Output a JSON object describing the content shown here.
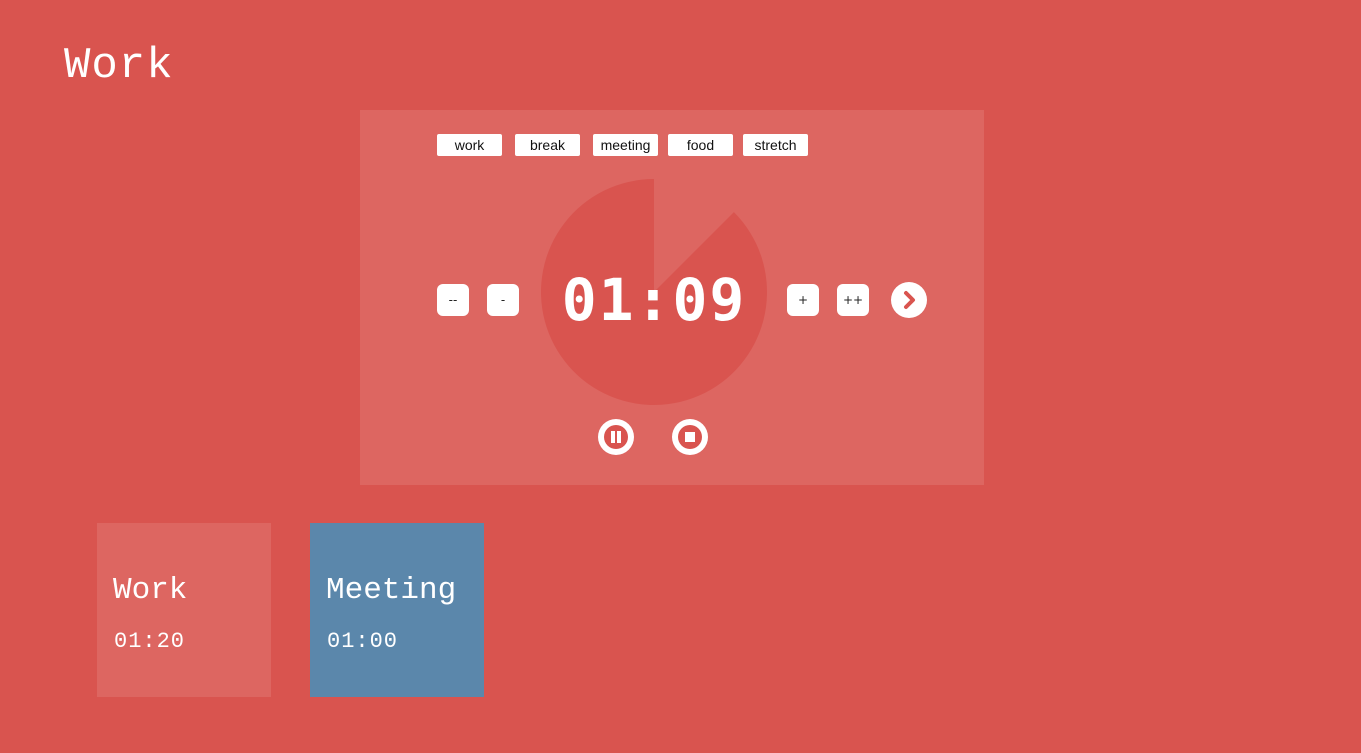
{
  "page": {
    "title": "Work"
  },
  "tags": [
    {
      "label": "work"
    },
    {
      "label": "break"
    },
    {
      "label": "meeting"
    },
    {
      "label": "food"
    },
    {
      "label": "stretch"
    }
  ],
  "timer": {
    "time": "01:09",
    "decrease_large_label": "--",
    "decrease_label": "-",
    "increase_label": "+",
    "increase_large_label": "++",
    "remaining_fraction": 0.875
  },
  "cards": [
    {
      "title": "Work",
      "time": "01:20",
      "color": "#dd6661"
    },
    {
      "title": "Meeting",
      "time": "01:00",
      "color": "#5b87ab"
    }
  ],
  "colors": {
    "background": "#d9544f",
    "panel": "#dd6661",
    "pie": "#d9544f",
    "meeting": "#5b87ab"
  },
  "icons": {
    "next": "chevron-right-icon",
    "pause": "pause-icon",
    "stop": "stop-icon"
  }
}
